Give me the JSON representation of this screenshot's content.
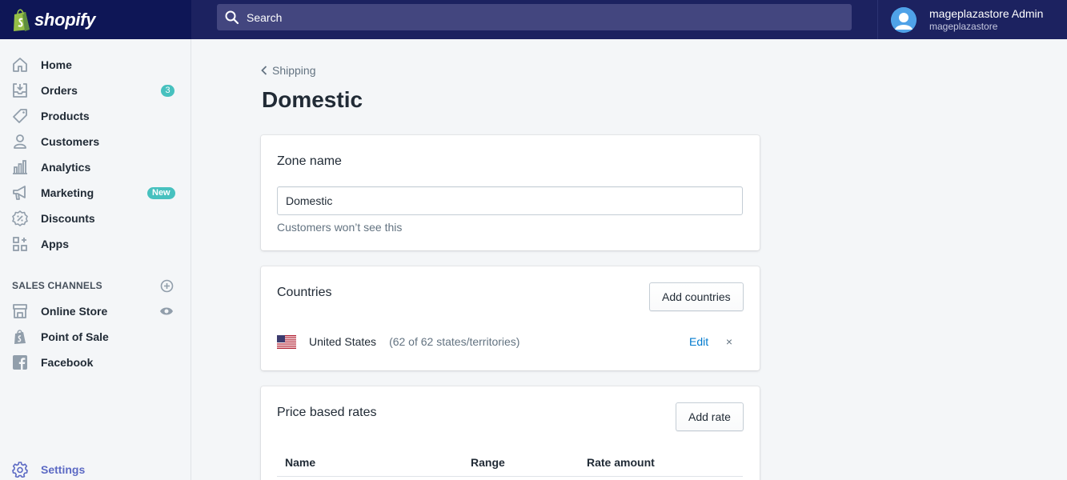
{
  "app": {
    "brand": "shopify",
    "search_placeholder": "Search",
    "user_name": "mageplazastore Admin",
    "user_store": "mageplazastore"
  },
  "colors": {
    "topbar": "#1c2260",
    "accent": "#5c6ac4",
    "badge": "#47c1bf",
    "link": "#007ace"
  },
  "sidebar": {
    "items": [
      {
        "label": "Home",
        "icon": "home-icon"
      },
      {
        "label": "Orders",
        "icon": "orders-icon",
        "badge": "3"
      },
      {
        "label": "Products",
        "icon": "tag-icon"
      },
      {
        "label": "Customers",
        "icon": "person-icon"
      },
      {
        "label": "Analytics",
        "icon": "bar-chart-icon"
      },
      {
        "label": "Marketing",
        "icon": "megaphone-icon",
        "badge": "New"
      },
      {
        "label": "Discounts",
        "icon": "discount-icon"
      },
      {
        "label": "Apps",
        "icon": "apps-icon"
      }
    ],
    "sales_channels_title": "SALES CHANNELS",
    "channels": [
      {
        "label": "Online Store",
        "icon": "store-icon"
      },
      {
        "label": "Point of Sale",
        "icon": "pos-bag-icon"
      },
      {
        "label": "Facebook",
        "icon": "facebook-icon"
      }
    ],
    "settings_label": "Settings"
  },
  "page": {
    "breadcrumb": "Shipping",
    "title": "Domestic"
  },
  "zone_card": {
    "title": "Zone name",
    "input_value": "Domestic",
    "help_text": "Customers won’t see this"
  },
  "countries_card": {
    "title": "Countries",
    "add_button": "Add countries",
    "country_name": "United States",
    "country_detail": "(62 of 62 states/territories)",
    "edit_label": "Edit",
    "remove_glyph": "×"
  },
  "rates_card": {
    "title": "Price based rates",
    "add_button": "Add rate",
    "columns": [
      "Name",
      "Range",
      "Rate amount"
    ]
  }
}
